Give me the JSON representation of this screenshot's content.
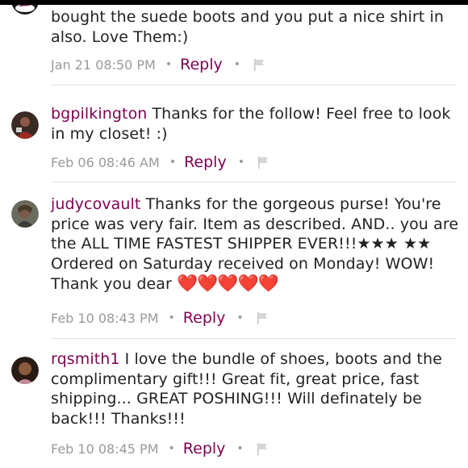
{
  "colors": {
    "accent": "#7f0353",
    "text": "#222222",
    "muted": "#9a9a9a",
    "divider": "#e2e2e2",
    "heart": "#d60f1c"
  },
  "comments": [
    {
      "username": "",
      "text_lines": [
        "bought the suede boots and you put a nice shirt in",
        "also. Love Them:)"
      ],
      "timestamp": "Jan 21 08:50 PM",
      "reply_label": "Reply",
      "flag_icon": "flag-icon"
    },
    {
      "username": "bgpilkington",
      "text": "Thanks for the follow! Feel free to look in my closet! :)",
      "timestamp": "Feb 06 08:46 AM",
      "reply_label": "Reply",
      "flag_icon": "flag-icon"
    },
    {
      "username": "judycovault",
      "text": "Thanks for the gorgeous purse! You're price was very fair. Item as described.  AND.. you are the ALL TIME FASTEST SHIPPER EVER!!!★★★ ★★ Ordered on Saturday received on Monday!  WOW! Thank you dear",
      "hearts": "❤️❤️❤️❤️❤️",
      "timestamp": "Feb 10 08:43 PM",
      "reply_label": "Reply",
      "flag_icon": "flag-icon"
    },
    {
      "username": "rqsmith1",
      "text": "I love the bundle of shoes, boots and the complimentary gift!!! Great fit, great price, fast shipping... GREAT POSHING!!! Will definately be back!!! Thanks!!!",
      "timestamp": "Feb 10 08:45 PM",
      "reply_label": "Reply",
      "flag_icon": "flag-icon"
    }
  ],
  "separator": "•"
}
